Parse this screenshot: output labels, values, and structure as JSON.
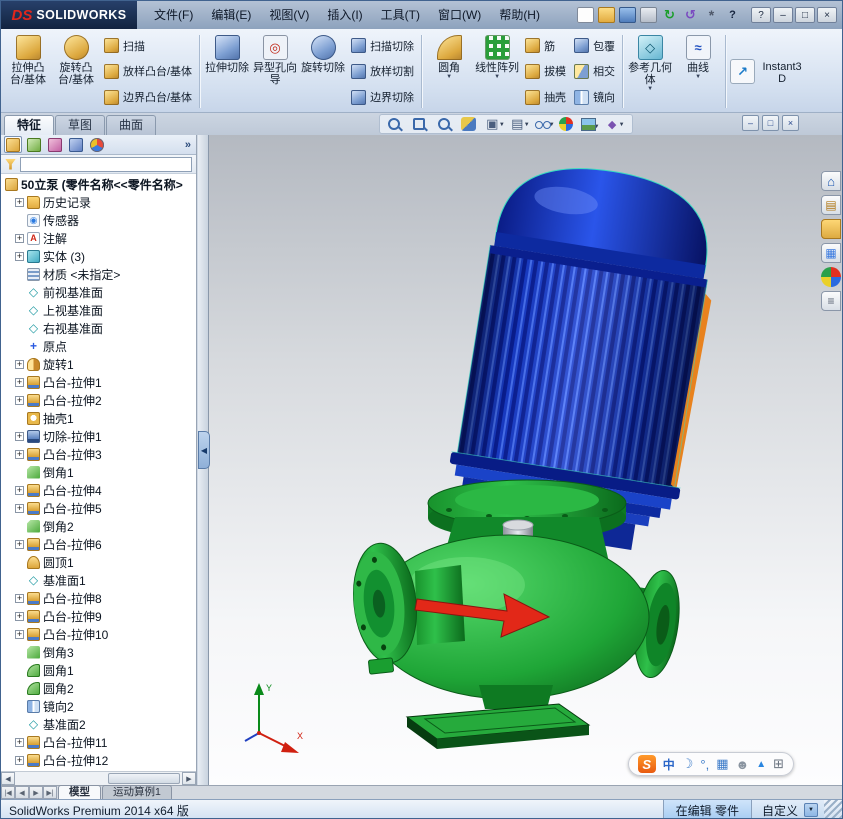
{
  "titlebar": {
    "brand": "DS",
    "app_name": "SOLIDWORKS",
    "menus": [
      {
        "label": "文件(F)"
      },
      {
        "label": "编辑(E)"
      },
      {
        "label": "视图(V)"
      },
      {
        "label": "插入(I)"
      },
      {
        "label": "工具(T)"
      },
      {
        "label": "窗口(W)"
      },
      {
        "label": "帮助(H)"
      }
    ],
    "quick_access_icons": [
      {
        "name": "new-document-icon"
      },
      {
        "name": "open-icon"
      },
      {
        "name": "save-icon"
      },
      {
        "name": "print-icon"
      },
      {
        "name": "rebuild-icon"
      },
      {
        "name": "undo-icon"
      },
      {
        "name": "options-icon"
      },
      {
        "name": "help-icon"
      }
    ],
    "window_controls": [
      {
        "name": "help-button",
        "glyph": "?"
      },
      {
        "name": "minimize-button",
        "glyph": "–"
      },
      {
        "name": "maximize-button",
        "glyph": "□"
      },
      {
        "name": "close-button",
        "glyph": "×"
      }
    ]
  },
  "ribbon": {
    "big_buttons": [
      {
        "label": "拉伸凸台/基体",
        "icon": "extrude-boss-icon"
      },
      {
        "label": "旋转凸台/基体",
        "icon": "revolve-boss-icon"
      },
      {
        "label": "拉伸切除",
        "icon": "extrude-cut-icon"
      },
      {
        "label": "异型孔向导",
        "icon": "hole-wizard-icon"
      },
      {
        "label": "旋转切除",
        "icon": "revolve-cut-icon"
      },
      {
        "label": "圆角",
        "icon": "fillet-icon"
      },
      {
        "label": "线性阵列",
        "icon": "linear-pattern-icon"
      },
      {
        "label": "参考几何体",
        "icon": "reference-geometry-icon"
      },
      {
        "label": "曲线",
        "icon": "curves-icon"
      },
      {
        "label": "Instant3D",
        "icon": "instant3d-icon"
      }
    ],
    "small_buttons_groups": [
      {
        "items": [
          {
            "label": "扫描",
            "icon": "sweep-icon"
          },
          {
            "label": "放样凸台/基体",
            "icon": "loft-icon"
          },
          {
            "label": "边界凸台/基体",
            "icon": "boundary-boss-icon"
          }
        ]
      },
      {
        "items": [
          {
            "label": "扫描切除",
            "icon": "sweep-cut-icon"
          },
          {
            "label": "放样切割",
            "icon": "loft-cut-icon"
          },
          {
            "label": "边界切除",
            "icon": "boundary-cut-icon"
          }
        ]
      },
      {
        "items": [
          {
            "label": "筋",
            "icon": "rib-icon"
          },
          {
            "label": "拔模",
            "icon": "draft-icon"
          },
          {
            "label": "抽壳",
            "icon": "shell-icon"
          }
        ]
      },
      {
        "items": [
          {
            "label": "包覆",
            "icon": "wrap-icon"
          },
          {
            "label": "相交",
            "icon": "intersect-icon"
          },
          {
            "label": "镜向",
            "icon": "mirror-icon"
          }
        ]
      }
    ]
  },
  "command_tabs": [
    {
      "label": "特征",
      "active": true
    },
    {
      "label": "草图",
      "active": false
    },
    {
      "label": "曲面",
      "active": false
    }
  ],
  "headsup": {
    "icons": [
      {
        "name": "zoom-fit-icon",
        "dropdown": false
      },
      {
        "name": "zoom-area-icon",
        "dropdown": false
      },
      {
        "name": "previous-view-icon",
        "dropdown": false
      },
      {
        "name": "section-view-icon",
        "dropdown": false
      },
      {
        "name": "view-orientation-icon",
        "dropdown": true
      },
      {
        "name": "display-style-icon",
        "dropdown": true
      },
      {
        "name": "hide-show-items-icon",
        "dropdown": true
      },
      {
        "name": "edit-appearance-icon",
        "dropdown": false
      },
      {
        "name": "apply-scene-icon",
        "dropdown": true
      },
      {
        "name": "view-settings-icon",
        "dropdown": true
      }
    ]
  },
  "doc_controls": [
    {
      "name": "doc-minimize-button",
      "glyph": "–"
    },
    {
      "name": "doc-restore-button",
      "glyph": "□"
    },
    {
      "name": "doc-close-button",
      "glyph": "×"
    }
  ],
  "feature_tree": {
    "panel_tabs": [
      {
        "icon": "featuremanager-tree-icon",
        "active": true
      },
      {
        "icon": "propertymanager-icon",
        "active": false
      },
      {
        "icon": "configurationmanager-icon",
        "active": false
      },
      {
        "icon": "dimxpertmanager-icon",
        "active": false
      },
      {
        "icon": "displaymanager-icon",
        "active": false
      }
    ],
    "overflow_chevron": "»",
    "filter_value": "",
    "root": {
      "label": "50立泵 (零件名称<<零件名称>",
      "icon": "part"
    },
    "items": [
      {
        "label": "历史记录",
        "icon": "history",
        "plus": true
      },
      {
        "label": "传感器",
        "icon": "sensors",
        "plus": false
      },
      {
        "label": "注解",
        "icon": "annotations",
        "plus": true
      },
      {
        "label": "实体 (3)",
        "icon": "solid-bodies",
        "plus": true
      },
      {
        "label": "材质 <未指定>",
        "icon": "material",
        "plus": false
      },
      {
        "label": "前视基准面",
        "icon": "plane",
        "plus": false
      },
      {
        "label": "上视基准面",
        "icon": "plane",
        "plus": false
      },
      {
        "label": "右视基准面",
        "icon": "plane",
        "plus": false
      },
      {
        "label": "原点",
        "icon": "origin",
        "plus": false
      },
      {
        "label": "旋转1",
        "icon": "revolve",
        "plus": true
      },
      {
        "label": "凸台-拉伸1",
        "icon": "extrude",
        "plus": true
      },
      {
        "label": "凸台-拉伸2",
        "icon": "extrude",
        "plus": true
      },
      {
        "label": "抽壳1",
        "icon": "shell",
        "plus": false
      },
      {
        "label": "切除-拉伸1",
        "icon": "cut-extrude",
        "plus": true
      },
      {
        "label": "凸台-拉伸3",
        "icon": "extrude",
        "plus": true
      },
      {
        "label": "倒角1",
        "icon": "chamfer",
        "plus": false
      },
      {
        "label": "凸台-拉伸4",
        "icon": "extrude",
        "plus": true
      },
      {
        "label": "凸台-拉伸5",
        "icon": "extrude",
        "plus": true
      },
      {
        "label": "倒角2",
        "icon": "chamfer",
        "plus": false
      },
      {
        "label": "凸台-拉伸6",
        "icon": "extrude",
        "plus": true
      },
      {
        "label": "圆顶1",
        "icon": "dome",
        "plus": false
      },
      {
        "label": "基准面1",
        "icon": "ref-plane",
        "plus": false
      },
      {
        "label": "凸台-拉伸8",
        "icon": "extrude",
        "plus": true
      },
      {
        "label": "凸台-拉伸9",
        "icon": "extrude",
        "plus": true
      },
      {
        "label": "凸台-拉伸10",
        "icon": "extrude",
        "plus": true
      },
      {
        "label": "倒角3",
        "icon": "chamfer",
        "plus": false
      },
      {
        "label": "圆角1",
        "icon": "fillet",
        "plus": false
      },
      {
        "label": "圆角2",
        "icon": "fillet",
        "plus": false
      },
      {
        "label": "镜向2",
        "icon": "mirror",
        "plus": false
      },
      {
        "label": "基准面2",
        "icon": "ref-plane",
        "plus": false
      },
      {
        "label": "凸台-拉伸11",
        "icon": "extrude",
        "plus": true
      },
      {
        "label": "凸台-拉伸12",
        "icon": "extrude",
        "plus": true
      }
    ]
  },
  "viewport": {
    "triad": {
      "x_label": "X",
      "y_label": "Y"
    }
  },
  "task_pane": {
    "icons": [
      {
        "name": "solidworks-resources-icon"
      },
      {
        "name": "design-library-icon"
      },
      {
        "name": "file-explorer-icon"
      },
      {
        "name": "view-palette-icon"
      },
      {
        "name": "appearances-scenes-icon"
      },
      {
        "name": "custom-properties-icon"
      }
    ]
  },
  "ime_bar": {
    "items": [
      {
        "name": "sogou-logo-icon",
        "glyph": "S"
      },
      {
        "name": "chinese-mode-icon",
        "glyph": "中"
      },
      {
        "name": "halfmoon-icon",
        "glyph": "☽"
      },
      {
        "name": "punctuation-icon",
        "glyph": "°,"
      },
      {
        "name": "keyboard-icon",
        "glyph": "▦"
      },
      {
        "name": "account-icon",
        "glyph": "☻"
      },
      {
        "name": "skin-icon",
        "glyph": "▲"
      },
      {
        "name": "toolbox-icon",
        "glyph": "⊞"
      }
    ]
  },
  "model_tabs": {
    "nav": [
      {
        "name": "nav-first",
        "glyph": "|◀"
      },
      {
        "name": "nav-prev",
        "glyph": "◀"
      },
      {
        "name": "nav-next",
        "glyph": "▶"
      },
      {
        "name": "nav-last",
        "glyph": "▶|"
      }
    ],
    "tabs": [
      {
        "label": "模型",
        "active": true
      },
      {
        "label": "运动算例1",
        "active": false
      }
    ]
  },
  "status_bar": {
    "left": "SolidWorks Premium 2014 x64 版",
    "editing": "在编辑 零件",
    "custom": "自定义"
  }
}
